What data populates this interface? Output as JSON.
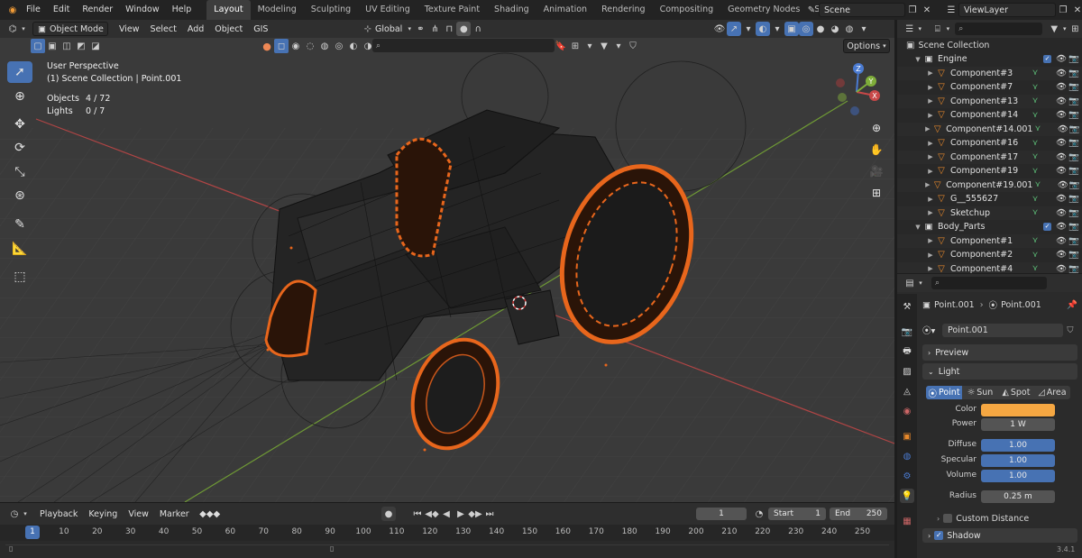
{
  "menu": [
    "File",
    "Edit",
    "Render",
    "Window",
    "Help"
  ],
  "workspaces": [
    "Layout",
    "Modeling",
    "Sculpting",
    "UV Editing",
    "Texture Paint",
    "Shading",
    "Animation",
    "Rendering",
    "Compositing",
    "Geometry Nodes",
    "Scripting"
  ],
  "workspace_add": "+",
  "scene_name": "Scene",
  "view_layer_name": "ViewLayer",
  "viewport": {
    "mode": "Object Mode",
    "header_menu": [
      "View",
      "Select",
      "Add",
      "Object",
      "GIS"
    ],
    "orientation": "Global",
    "options_label": "Options",
    "overlay_title": "User Perspective",
    "overlay_sub": "(1) Scene Collection | Point.001",
    "stats": [
      {
        "label": "Objects",
        "value": "4 / 72"
      },
      {
        "label": "Lights",
        "value": "0 / 7"
      }
    ],
    "gizmo": {
      "z": "Z",
      "y": "Y",
      "x": "X"
    }
  },
  "timeline": {
    "menu": [
      "Playback",
      "Keying",
      "View",
      "Marker"
    ],
    "current_frame": "1",
    "start_label": "Start",
    "start": "1",
    "end_label": "End",
    "end": "250",
    "ticks": [
      "1",
      "10",
      "20",
      "30",
      "40",
      "50",
      "60",
      "70",
      "80",
      "90",
      "100",
      "110",
      "120",
      "130",
      "140",
      "150",
      "160",
      "170",
      "180",
      "190",
      "200",
      "210",
      "220",
      "230",
      "240",
      "250"
    ]
  },
  "outliner": {
    "root": "Scene Collection",
    "rows": [
      {
        "name": "Engine",
        "type": "collection"
      },
      {
        "name": "Component#3",
        "type": "object"
      },
      {
        "name": "Component#7",
        "type": "object"
      },
      {
        "name": "Component#13",
        "type": "object"
      },
      {
        "name": "Component#14",
        "type": "object"
      },
      {
        "name": "Component#14.001",
        "type": "object"
      },
      {
        "name": "Component#16",
        "type": "object"
      },
      {
        "name": "Component#17",
        "type": "object"
      },
      {
        "name": "Component#19",
        "type": "object"
      },
      {
        "name": "Component#19.001",
        "type": "object"
      },
      {
        "name": "G__555627",
        "type": "object"
      },
      {
        "name": "Sketchup",
        "type": "object"
      },
      {
        "name": "Body_Parts",
        "type": "collection"
      },
      {
        "name": "Component#1",
        "type": "object"
      },
      {
        "name": "Component#2",
        "type": "object"
      },
      {
        "name": "Component#4",
        "type": "object"
      }
    ]
  },
  "properties": {
    "breadcrumb_object": "Point.001",
    "breadcrumb_data": "Point.001",
    "datablock": "Point.001",
    "preview_label": "Preview",
    "light_label": "Light",
    "light_types": [
      "Point",
      "Sun",
      "Spot",
      "Area"
    ],
    "active_light_type": "Point",
    "color_label": "Color",
    "color_value": "#f5a742",
    "power_label": "Power",
    "power": "1 W",
    "diffuse_label": "Diffuse",
    "diffuse": "1.00",
    "specular_label": "Specular",
    "specular": "1.00",
    "volume_label": "Volume",
    "volume": "1.00",
    "radius_label": "Radius",
    "radius": "0.25 m",
    "custom_distance_label": "Custom Distance",
    "shadow_label": "Shadow"
  },
  "version": "3.4.1",
  "colors": {
    "accent": "#4772b3",
    "selection": "#e8661c",
    "axis_x": "#c84848",
    "axis_y": "#7fae3a"
  }
}
